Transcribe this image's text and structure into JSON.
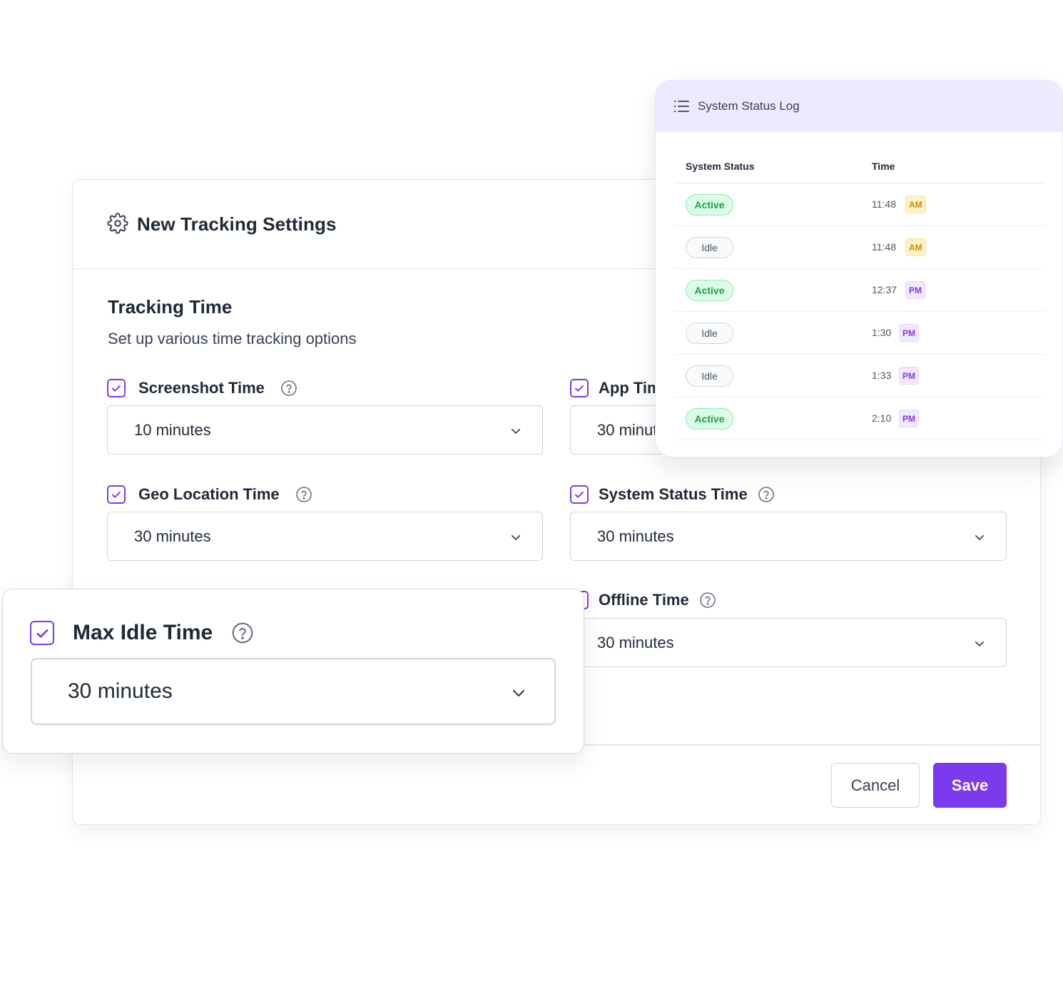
{
  "settings": {
    "title": "New Tracking Settings",
    "section_title": "Tracking Time",
    "section_subtitle": "Set up various time tracking options",
    "fields": [
      {
        "label": "Screenshot Time",
        "checked": true,
        "value": "10 minutes"
      },
      {
        "label": "App Time",
        "checked": true,
        "value": "30 minutes"
      },
      {
        "label": "Geo Location Time",
        "checked": true,
        "value": "30 minutes"
      },
      {
        "label": "System Status Time",
        "checked": true,
        "value": "30 minutes"
      },
      {
        "label": "Offline Time",
        "checked": true,
        "value": "30 minutes"
      }
    ],
    "cancel_label": "Cancel",
    "save_label": "Save"
  },
  "idle_card": {
    "label": "Max Idle Time",
    "checked": true,
    "value": "30 minutes"
  },
  "status_log": {
    "title": "System Status Log",
    "columns": [
      "System Status",
      "Time"
    ],
    "rows": [
      {
        "status": "Active",
        "time": "11:48",
        "period": "AM"
      },
      {
        "status": "Idle",
        "time": "11:48",
        "period": "AM"
      },
      {
        "status": "Active",
        "time": "12:37",
        "period": "PM"
      },
      {
        "status": "Idle",
        "time": "1:30",
        "period": "PM"
      },
      {
        "status": "Idle",
        "time": "1:33",
        "period": "PM"
      },
      {
        "status": "Active",
        "time": "2:10",
        "period": "PM"
      }
    ]
  },
  "icons": {
    "title_icon": "gear-icon",
    "help_icon": "question-circle-icon",
    "dropdown_icon": "chevron-down-icon",
    "log_icon": "list-icon",
    "checkbox_icon": "checkmark-icon"
  },
  "colors": {
    "accent": "#7c3aed",
    "log_header_bg": "#ede9fe",
    "active_green": "#16a34a",
    "am_yellow": "#ca8a04"
  }
}
